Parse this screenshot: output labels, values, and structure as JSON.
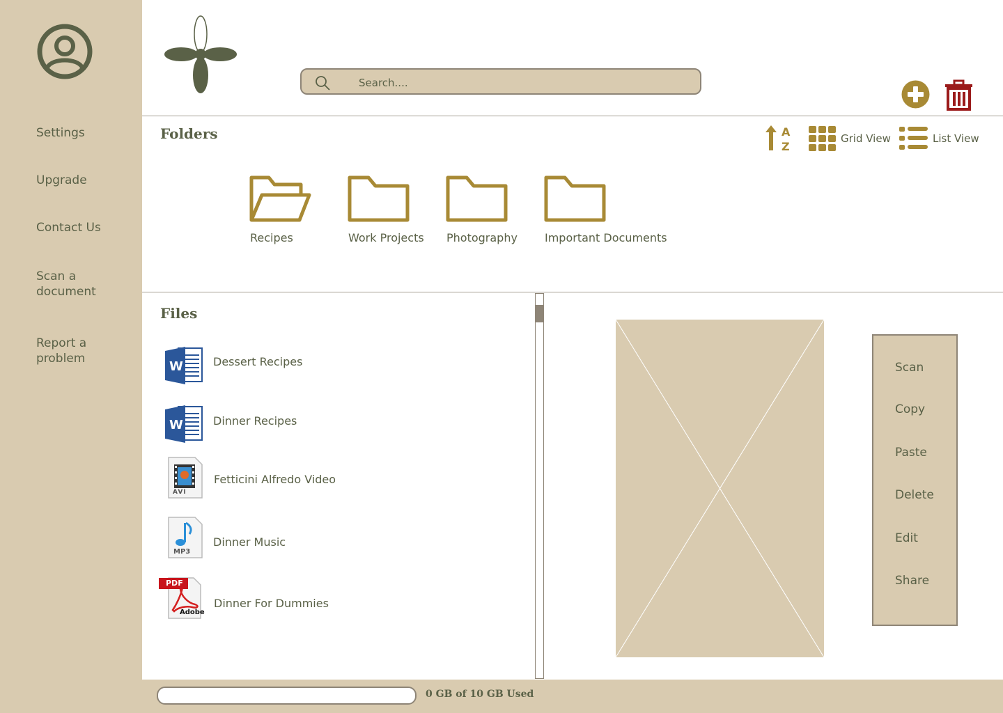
{
  "sidebar": {
    "avatar_icon": "user-circle-icon",
    "items": [
      {
        "label": "Settings"
      },
      {
        "label": "Upgrade"
      },
      {
        "label": "Contact Us"
      },
      {
        "label": "Scan a document"
      },
      {
        "label": "Report a problem"
      }
    ]
  },
  "header": {
    "logo_icon": "four-petal-flower-logo",
    "search": {
      "placeholder": "Search...."
    },
    "add_icon": "plus-circle-icon",
    "delete_icon": "trash-icon"
  },
  "folders": {
    "title": "Folders",
    "sort_icon": "sort-a-z-icon",
    "grid_view_label": "Grid View",
    "list_view_label": "List View",
    "items": [
      {
        "label": "Recipes",
        "icon": "folder-open-icon"
      },
      {
        "label": "Work Projects",
        "icon": "folder-icon"
      },
      {
        "label": "Photography",
        "icon": "folder-icon"
      },
      {
        "label": "Important Documents",
        "icon": "folder-icon"
      }
    ]
  },
  "files": {
    "title": "Files",
    "items": [
      {
        "name": "Dessert Recipes",
        "icon": "word-doc-icon"
      },
      {
        "name": "Dinner Recipes",
        "icon": "word-doc-icon"
      },
      {
        "name": "Fetticini Alfredo Video",
        "icon": "avi-video-icon",
        "badge": "AVI"
      },
      {
        "name": "Dinner Music",
        "icon": "mp3-audio-icon",
        "badge": "MP3"
      },
      {
        "name": "Dinner For Dummies",
        "icon": "pdf-icon",
        "badge": "PDF",
        "sub_badge": "Adobe"
      }
    ]
  },
  "context_menu": {
    "items": [
      {
        "label": "Scan"
      },
      {
        "label": "Copy"
      },
      {
        "label": "Paste"
      },
      {
        "label": "Delete"
      },
      {
        "label": "Edit"
      },
      {
        "label": "Share"
      }
    ]
  },
  "storage": {
    "label": "0 GB of 10 GB Used",
    "used_fraction": 0
  },
  "colors": {
    "sidebar_bg": "#d9cbb0",
    "text": "#5a6147",
    "folder": "#a88a35",
    "trash": "#9b1b1b",
    "logo_green": "#5a6147"
  }
}
